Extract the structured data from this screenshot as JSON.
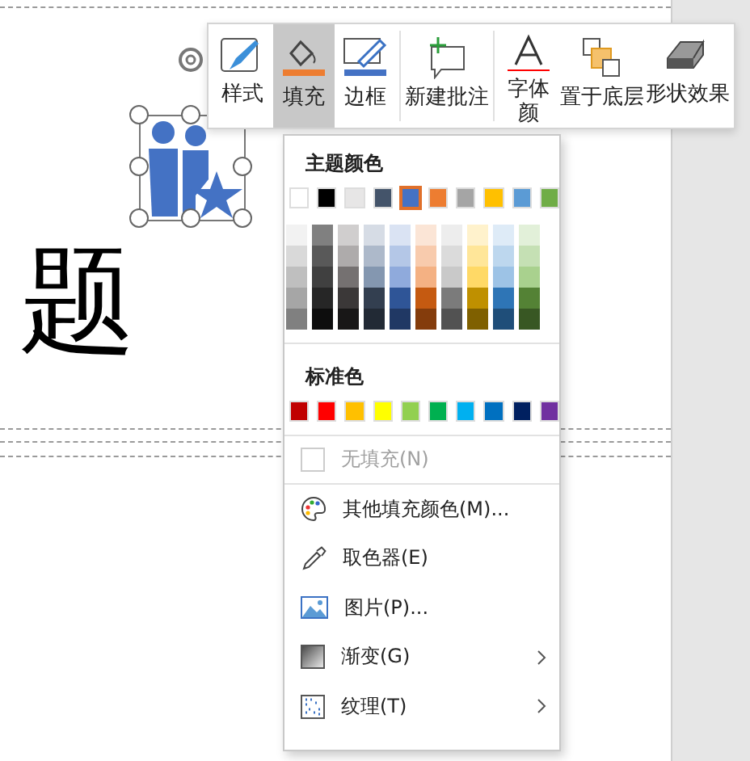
{
  "slide": {
    "title": "题"
  },
  "toolbar": [
    {
      "kind": "style",
      "label": "样式",
      "selected": false
    },
    {
      "kind": "fill",
      "label": "填充",
      "selected": true,
      "color": "#ed7d31"
    },
    {
      "kind": "border",
      "label": "边框",
      "selected": false,
      "color": "#4472c4"
    },
    {
      "kind": "comment",
      "label": "新建批注",
      "selected": false
    },
    {
      "kind": "font",
      "label": "字体颜",
      "selected": false,
      "color": "#ff0000"
    },
    {
      "kind": "back",
      "label": "置于底层",
      "selected": false
    },
    {
      "kind": "effect",
      "label": "形状效果",
      "selected": false
    }
  ],
  "fill_menu": {
    "theme_heading": "主题颜色",
    "theme_colors": [
      {
        "color": "#ffffff",
        "selected": false,
        "shades": [
          {
            "color": "#f2f2f2"
          },
          {
            "color": "#d9d9d9"
          },
          {
            "color": "#bfbfbf"
          },
          {
            "color": "#a6a6a6"
          },
          {
            "color": "#808080"
          }
        ]
      },
      {
        "color": "#000000",
        "selected": false,
        "shades": [
          {
            "color": "#808080"
          },
          {
            "color": "#595959"
          },
          {
            "color": "#404040"
          },
          {
            "color": "#262626"
          },
          {
            "color": "#0d0d0d"
          }
        ]
      },
      {
        "color": "#e7e6e6",
        "selected": false,
        "shades": [
          {
            "color": "#d0cece"
          },
          {
            "color": "#aeabab"
          },
          {
            "color": "#757171"
          },
          {
            "color": "#3b3838"
          },
          {
            "color": "#181717"
          }
        ]
      },
      {
        "color": "#44546a",
        "selected": false,
        "shades": [
          {
            "color": "#d6dce5"
          },
          {
            "color": "#adb9ca"
          },
          {
            "color": "#8497b0"
          },
          {
            "color": "#333f50"
          },
          {
            "color": "#222a35"
          }
        ]
      },
      {
        "color": "#4472c4",
        "selected": true,
        "shades": [
          {
            "color": "#dae3f3"
          },
          {
            "color": "#b4c7e7"
          },
          {
            "color": "#8faadc"
          },
          {
            "color": "#2f5597"
          },
          {
            "color": "#203864"
          }
        ]
      },
      {
        "color": "#ed7d31",
        "selected": false,
        "shades": [
          {
            "color": "#fbe5d6"
          },
          {
            "color": "#f8cbad"
          },
          {
            "color": "#f4b183"
          },
          {
            "color": "#c55a11"
          },
          {
            "color": "#843c0c"
          }
        ]
      },
      {
        "color": "#a5a5a5",
        "selected": false,
        "shades": [
          {
            "color": "#ededed"
          },
          {
            "color": "#dbdbdb"
          },
          {
            "color": "#c9c9c9"
          },
          {
            "color": "#7b7b7b"
          },
          {
            "color": "#525252"
          }
        ]
      },
      {
        "color": "#ffc000",
        "selected": false,
        "shades": [
          {
            "color": "#fff2cc"
          },
          {
            "color": "#ffe699"
          },
          {
            "color": "#ffd966"
          },
          {
            "color": "#bf9000"
          },
          {
            "color": "#7f6000"
          }
        ]
      },
      {
        "color": "#5b9bd5",
        "selected": false,
        "shades": [
          {
            "color": "#deebf7"
          },
          {
            "color": "#bdd7ee"
          },
          {
            "color": "#9dc3e6"
          },
          {
            "color": "#2e75b6"
          },
          {
            "color": "#1f4e79"
          }
        ]
      },
      {
        "color": "#70ad47",
        "selected": false,
        "shades": [
          {
            "color": "#e2f0d9"
          },
          {
            "color": "#c5e0b4"
          },
          {
            "color": "#a9d18e"
          },
          {
            "color": "#548235"
          },
          {
            "color": "#385723"
          }
        ]
      }
    ],
    "standard_heading": "标准色",
    "standard_colors": [
      {
        "color": "#c00000"
      },
      {
        "color": "#ff0000"
      },
      {
        "color": "#ffc000"
      },
      {
        "color": "#ffff00"
      },
      {
        "color": "#92d050"
      },
      {
        "color": "#00b050"
      },
      {
        "color": "#00b0f0"
      },
      {
        "color": "#0070c0"
      },
      {
        "color": "#002060"
      },
      {
        "color": "#7030a0"
      }
    ],
    "no_fill": {
      "label": "无填充(N)",
      "disabled": true
    },
    "items": [
      {
        "kind": "palette",
        "label": "其他填充颜色(M)...",
        "submenu": false
      },
      {
        "kind": "eyedropper",
        "label": "取色器(E)",
        "submenu": false
      },
      {
        "kind": "picture",
        "label": "图片(P)...",
        "submenu": false
      },
      {
        "kind": "gradient",
        "label": "渐变(G)",
        "submenu": true
      },
      {
        "kind": "texture",
        "label": "纹理(T)",
        "submenu": true
      }
    ]
  }
}
